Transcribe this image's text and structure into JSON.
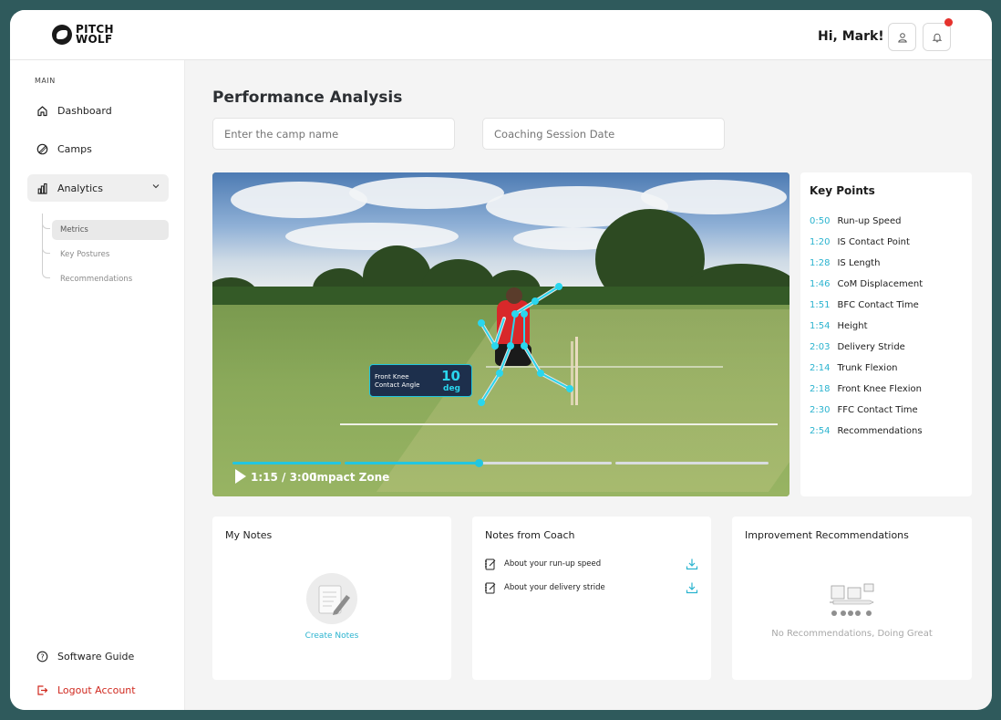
{
  "brand": {
    "line1": "PITCH",
    "line2": "WOLF",
    "icon": "wolf-logo"
  },
  "header": {
    "greeting": "Hi, Mark!",
    "user_icon": "user-icon",
    "bell_icon": "bell-icon",
    "notification_color": "#e5322d"
  },
  "sidebar": {
    "section_label": "MAIN",
    "items": [
      {
        "label": "Dashboard",
        "icon": "home-icon"
      },
      {
        "label": "Camps",
        "icon": "ball-icon"
      },
      {
        "label": "Analytics",
        "icon": "bar-chart-icon",
        "expanded": true
      }
    ],
    "subitems": [
      {
        "label": "Metrics",
        "active": true
      },
      {
        "label": "Key Postures"
      },
      {
        "label": "Recommendations"
      }
    ],
    "bottom": [
      {
        "label": "Software Guide",
        "icon": "help-icon"
      },
      {
        "label": "Logout Account",
        "icon": "logout-icon"
      }
    ]
  },
  "main": {
    "title": "Performance Analysis",
    "camp_input": {
      "placeholder": "Enter the camp name",
      "value": ""
    },
    "date_input": {
      "placeholder": "Coaching Session Date",
      "value": ""
    }
  },
  "video": {
    "overlay_label_line1": "Front Knee",
    "overlay_label_line2": "Contact Angle",
    "overlay_value": "10",
    "overlay_unit": "deg",
    "time": "1:15 / 3:00",
    "zone": "Impact Zone",
    "progress_fraction": 0.417,
    "accent": "#23c6e0"
  },
  "key_points": {
    "title": "Key Points",
    "items": [
      {
        "time": "0:50",
        "label": "Run-up Speed"
      },
      {
        "time": "1:20",
        "label": "IS Contact Point"
      },
      {
        "time": "1:28",
        "label": "IS Length"
      },
      {
        "time": "1:46",
        "label": "CoM Displacement"
      },
      {
        "time": "1:51",
        "label": "BFC Contact Time"
      },
      {
        "time": "1:54",
        "label": "Height"
      },
      {
        "time": "2:03",
        "label": "Delivery Stride"
      },
      {
        "time": "2:14",
        "label": "Trunk Flexion"
      },
      {
        "time": "2:18",
        "label": "Front Knee Flexion"
      },
      {
        "time": "2:30",
        "label": "FFC Contact Time"
      },
      {
        "time": "2:54",
        "label": "Recommendations"
      }
    ]
  },
  "cards": {
    "my_notes": {
      "title": "My Notes",
      "action": "Create Notes"
    },
    "coach_notes": {
      "title": "Notes from Coach",
      "items": [
        {
          "label": "About your run-up speed"
        },
        {
          "label": "About your delivery stride"
        }
      ]
    },
    "recommendations": {
      "title": "Improvement Recommendations",
      "empty_text": "No Recommendations, Doing Great"
    }
  }
}
